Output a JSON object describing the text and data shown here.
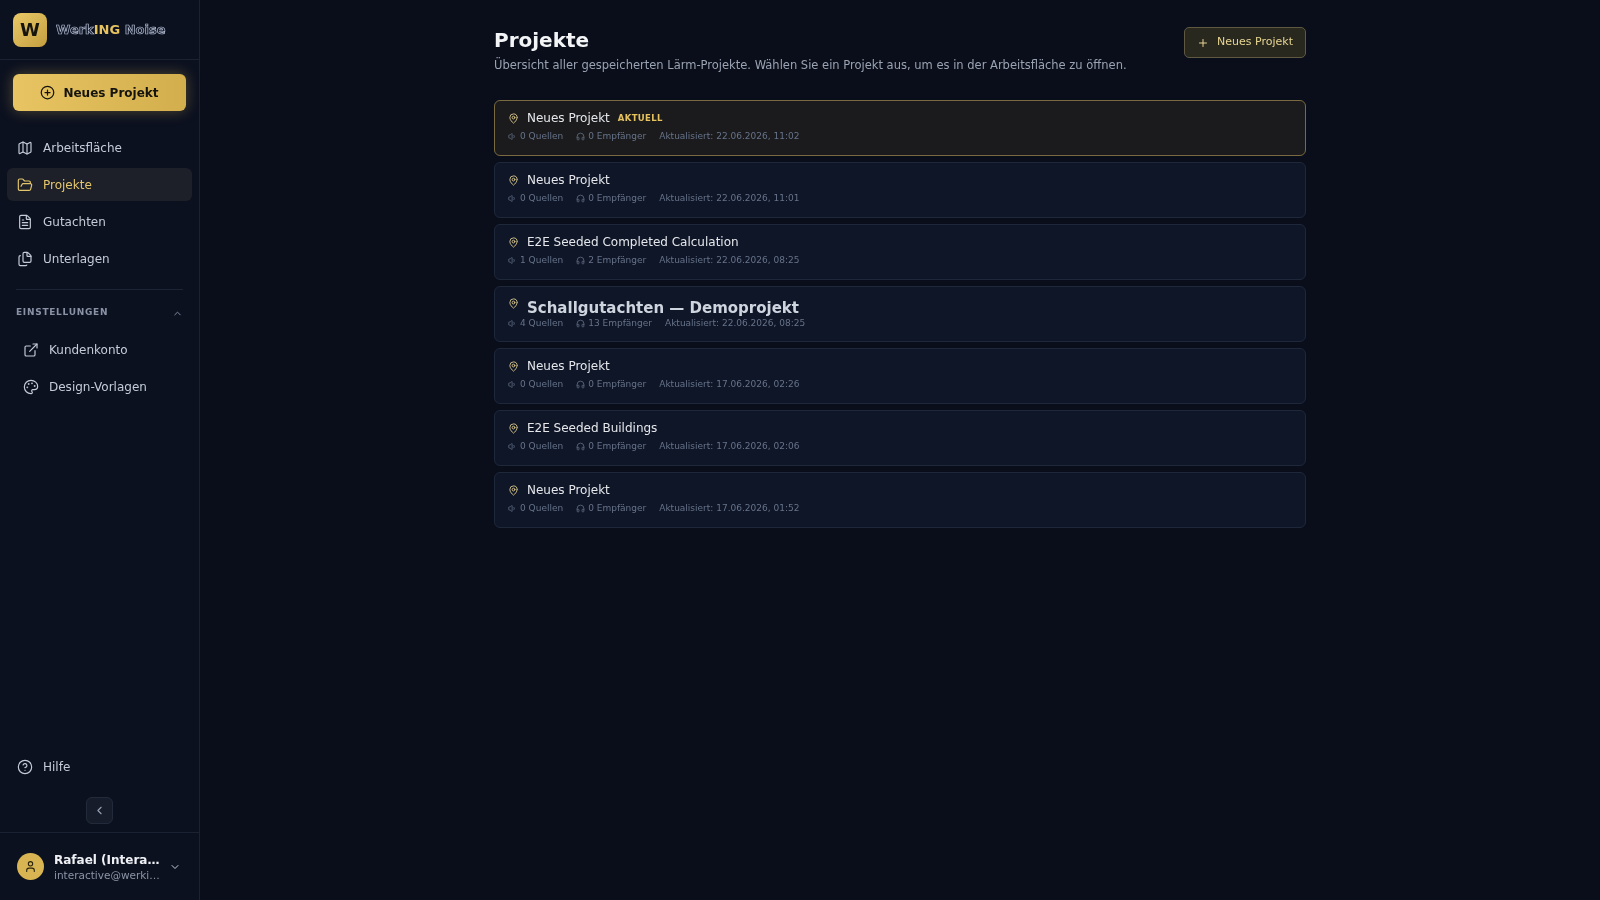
{
  "sidebar": {
    "logo": {
      "mark": "W",
      "words": [
        [
          {
            "text": "Werk",
            "kind": "outline"
          },
          {
            "text": "ING",
            "kind": "accent"
          }
        ],
        [
          {
            "text": "Noise",
            "kind": "outline"
          }
        ]
      ]
    },
    "new_project_button": "Neues Projekt",
    "nav": [
      {
        "label": "Arbeitsfläche",
        "selected": false
      },
      {
        "label": "Projekte",
        "selected": true
      },
      {
        "label": "Gutachten",
        "selected": false
      },
      {
        "label": "Unterlagen",
        "selected": false
      }
    ],
    "settings": {
      "title": "EINSTELLUNGEN",
      "expanded": true,
      "items": [
        {
          "label": "Kundenkonto",
          "selected": false
        },
        {
          "label": "Design-Vorlagen",
          "selected": false
        }
      ]
    },
    "help": "Hilfe",
    "user": {
      "name": "Rafael (Intera…",
      "email": "interactive@werki…"
    }
  },
  "main": {
    "title": "Projekte",
    "subtitle": "Übersicht aller gespeicherten Lärm-Projekte. Wählen Sie ein Projekt aus, um es in der Arbeitsfläche zu öffnen.",
    "new_project_button": "Neues Projekt",
    "projects": [
      {
        "title": "Neues Projekt",
        "kind": "standard",
        "badge": "AKTUELL",
        "selected": true,
        "sources": "0 Quellen",
        "receivers": "0 Empfänger",
        "updated": "Aktualisiert: 22.06.2026, 11:02"
      },
      {
        "title": "Neues Projekt",
        "kind": "standard",
        "selected": false,
        "sources": "0 Quellen",
        "receivers": "0 Empfänger",
        "updated": "Aktualisiert: 22.06.2026, 11:01"
      },
      {
        "title": "E2E Seeded Completed Calculation",
        "kind": "standard",
        "selected": false,
        "sources": "1 Quellen",
        "receivers": "2 Empfänger",
        "updated": "Aktualisiert: 22.06.2026, 08:25"
      },
      {
        "title": "Schallgutachten — Demoprojekt",
        "kind": "featured",
        "selected": false,
        "sources": "4 Quellen",
        "receivers": "13 Empfänger",
        "updated": "Aktualisiert: 22.06.2026, 08:25"
      },
      {
        "title": "Neues Projekt",
        "kind": "standard",
        "selected": false,
        "sources": "0 Quellen",
        "receivers": "0 Empfänger",
        "updated": "Aktualisiert: 17.06.2026, 02:26"
      },
      {
        "title": "E2E Seeded Buildings",
        "kind": "standard",
        "selected": false,
        "sources": "0 Quellen",
        "receivers": "0 Empfänger",
        "updated": "Aktualisiert: 17.06.2026, 02:06"
      },
      {
        "title": "Neues Projekt",
        "kind": "standard",
        "selected": false,
        "sources": "0 Quellen",
        "receivers": "0 Empfänger",
        "updated": "Aktualisiert: 17.06.2026, 01:52"
      }
    ]
  }
}
